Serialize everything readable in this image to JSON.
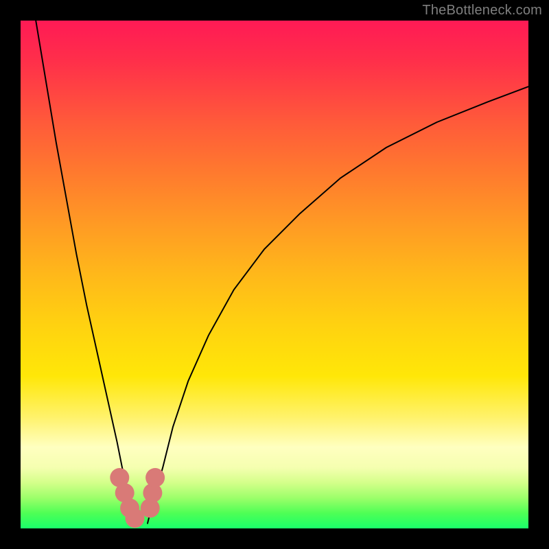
{
  "watermark": {
    "text": "TheBottleneck.com"
  },
  "colors": {
    "curve": "#000000",
    "marker": "#d97a77",
    "frame": "#000000"
  },
  "chart_data": {
    "type": "line",
    "title": "",
    "xlabel": "",
    "ylabel": "",
    "xlim": [
      0,
      100
    ],
    "ylim": [
      0,
      100
    ],
    "series": [
      {
        "name": "left-curve",
        "x": [
          3,
          5,
          7,
          9,
          11,
          13,
          15,
          17,
          19,
          20,
          21,
          22,
          22.5
        ],
        "y": [
          100,
          88,
          76,
          65,
          54,
          44,
          35,
          26,
          17,
          12,
          8,
          4,
          1
        ]
      },
      {
        "name": "right-curve",
        "x": [
          25,
          26,
          28,
          30,
          33,
          37,
          42,
          48,
          55,
          63,
          72,
          82,
          92,
          100
        ],
        "y": [
          1,
          5,
          12,
          20,
          29,
          38,
          47,
          55,
          62,
          69,
          75,
          80,
          84,
          87
        ]
      }
    ],
    "markers": [
      {
        "name": "cluster-left-1",
        "x": 19.5,
        "y": 10
      },
      {
        "name": "cluster-left-2",
        "x": 20.5,
        "y": 7
      },
      {
        "name": "cluster-left-3",
        "x": 21.5,
        "y": 4
      },
      {
        "name": "cluster-left-4",
        "x": 22.5,
        "y": 2
      },
      {
        "name": "cluster-right-1",
        "x": 25.5,
        "y": 4
      },
      {
        "name": "cluster-right-2",
        "x": 26.0,
        "y": 7
      },
      {
        "name": "cluster-right-3",
        "x": 26.5,
        "y": 10
      }
    ]
  }
}
